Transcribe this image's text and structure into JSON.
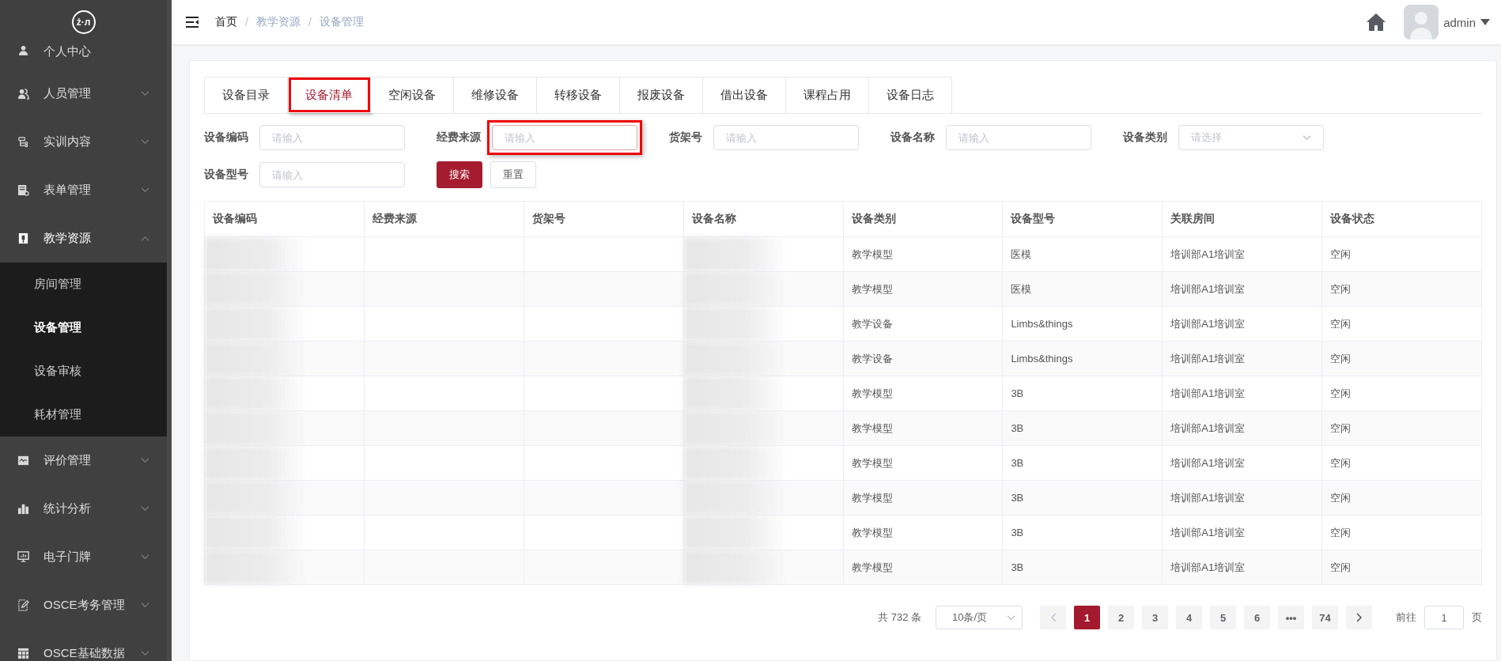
{
  "sidebar": {
    "logo": "ż·л",
    "items": [
      {
        "label": "个人中心",
        "kind": "link",
        "expanded": false
      },
      {
        "label": "人员管理",
        "kind": "menu",
        "expanded": false
      },
      {
        "label": "实训内容",
        "kind": "menu",
        "expanded": false
      },
      {
        "label": "表单管理",
        "kind": "menu",
        "expanded": false
      },
      {
        "label": "教学资源",
        "kind": "menu",
        "expanded": true,
        "children": [
          {
            "label": "房间管理",
            "selected": false
          },
          {
            "label": "设备管理",
            "selected": true
          },
          {
            "label": "设备审核",
            "selected": false
          },
          {
            "label": "耗材管理",
            "selected": false
          }
        ]
      },
      {
        "label": "评价管理",
        "kind": "menu",
        "expanded": false
      },
      {
        "label": "统计分析",
        "kind": "menu",
        "expanded": false
      },
      {
        "label": "电子门牌",
        "kind": "menu",
        "expanded": false
      },
      {
        "label": "OSCE考务管理",
        "kind": "menu",
        "expanded": false
      },
      {
        "label": "OSCE基础数据",
        "kind": "menu",
        "expanded": false
      }
    ]
  },
  "header": {
    "breadcrumb": [
      {
        "label": "首页",
        "current": false
      },
      {
        "label": "教学资源",
        "current": true
      },
      {
        "label": "设备管理",
        "current": true
      }
    ],
    "separator": "/",
    "user": "admin"
  },
  "tabs": [
    {
      "label": "设备目录",
      "selected": false,
      "highlighted": false
    },
    {
      "label": "设备清单",
      "selected": true,
      "highlighted": true
    },
    {
      "label": "空闲设备",
      "selected": false,
      "highlighted": false
    },
    {
      "label": "维修设备",
      "selected": false,
      "highlighted": false
    },
    {
      "label": "转移设备",
      "selected": false,
      "highlighted": false
    },
    {
      "label": "报废设备",
      "selected": false,
      "highlighted": false
    },
    {
      "label": "借出设备",
      "selected": false,
      "highlighted": false
    },
    {
      "label": "课程占用",
      "selected": false,
      "highlighted": false
    },
    {
      "label": "设备日志",
      "selected": false,
      "highlighted": false
    }
  ],
  "filters": [
    {
      "label": "设备编码",
      "placeholder": "请输入",
      "kind": "input",
      "highlighted": false
    },
    {
      "label": "经费来源",
      "placeholder": "请输入",
      "kind": "input",
      "highlighted": true
    },
    {
      "label": "货架号",
      "placeholder": "请输入",
      "kind": "input",
      "highlighted": false
    },
    {
      "label": "设备名称",
      "placeholder": "请输入",
      "kind": "input",
      "highlighted": false
    },
    {
      "label": "设备类别",
      "placeholder": "请选择",
      "kind": "select",
      "highlighted": false
    },
    {
      "label": "设备型号",
      "placeholder": "请输入",
      "kind": "input",
      "highlighted": false
    }
  ],
  "buttons": [
    {
      "label": "搜索",
      "kind": "primary"
    },
    {
      "label": "重置",
      "kind": "plain"
    }
  ],
  "table": {
    "columns": [
      "设备编码",
      "经费来源",
      "货架号",
      "设备名称",
      "设备类别",
      "设备型号",
      "关联房间",
      "设备状态"
    ],
    "rows": [
      [
        "",
        "",
        "",
        "",
        "教学模型",
        "医模",
        "培训部A1培训室",
        "空闲"
      ],
      [
        "",
        "",
        "",
        "",
        "教学模型",
        "医模",
        "培训部A1培训室",
        "空闲"
      ],
      [
        "",
        "",
        "",
        "",
        "教学设备",
        "Limbs&things",
        "培训部A1培训室",
        "空闲"
      ],
      [
        "",
        "",
        "",
        "",
        "教学设备",
        "Limbs&things",
        "培训部A1培训室",
        "空闲"
      ],
      [
        "",
        "",
        "",
        "",
        "教学模型",
        "3B",
        "培训部A1培训室",
        "空闲"
      ],
      [
        "",
        "",
        "",
        "",
        "教学模型",
        "3B",
        "培训部A1培训室",
        "空闲"
      ],
      [
        "",
        "",
        "",
        "",
        "教学模型",
        "3B",
        "培训部A1培训室",
        "空闲"
      ],
      [
        "",
        "",
        "",
        "",
        "教学模型",
        "3B",
        "培训部A1培训室",
        "空闲"
      ],
      [
        "",
        "",
        "",
        "",
        "教学模型",
        "3B",
        "培训部A1培训室",
        "空闲"
      ],
      [
        "",
        "",
        "",
        "",
        "教学模型",
        "3B",
        "培训部A1培训室",
        "空闲"
      ]
    ]
  },
  "pagination": {
    "total": "共 732 条",
    "page_size": "10条/页",
    "pages": [
      {
        "label": "1",
        "selected": true
      },
      {
        "label": "2",
        "selected": false
      },
      {
        "label": "3",
        "selected": false
      },
      {
        "label": "4",
        "selected": false
      },
      {
        "label": "5",
        "selected": false
      },
      {
        "label": "6",
        "selected": false
      },
      {
        "label": "•••",
        "selected": false
      },
      {
        "label": "74",
        "selected": false
      }
    ],
    "goto_label": "前往",
    "goto_value": "1",
    "goto_suffix": "页"
  }
}
